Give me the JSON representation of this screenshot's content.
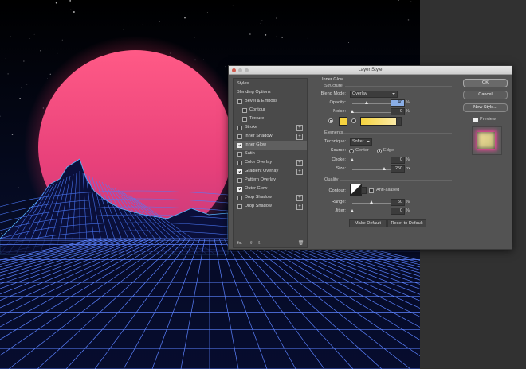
{
  "dialog": {
    "title": "Layer Style"
  },
  "styles_panel": {
    "header": "Styles",
    "items": [
      {
        "label": "Blending Options",
        "checkbox": false,
        "checked": false,
        "plus": false,
        "sub": false
      },
      {
        "label": "Bevel & Emboss",
        "checkbox": true,
        "checked": false,
        "plus": false,
        "sub": false
      },
      {
        "label": "Contour",
        "checkbox": true,
        "checked": false,
        "plus": false,
        "sub": true
      },
      {
        "label": "Texture",
        "checkbox": true,
        "checked": false,
        "plus": false,
        "sub": true
      },
      {
        "label": "Stroke",
        "checkbox": true,
        "checked": false,
        "plus": true,
        "sub": false
      },
      {
        "label": "Inner Shadow",
        "checkbox": true,
        "checked": false,
        "plus": true,
        "sub": false
      },
      {
        "label": "Inner Glow",
        "checkbox": true,
        "checked": true,
        "plus": false,
        "sub": false,
        "selected": true
      },
      {
        "label": "Satin",
        "checkbox": true,
        "checked": false,
        "plus": false,
        "sub": false
      },
      {
        "label": "Color Overlay",
        "checkbox": true,
        "checked": false,
        "plus": true,
        "sub": false
      },
      {
        "label": "Gradient Overlay",
        "checkbox": true,
        "checked": true,
        "plus": true,
        "sub": false
      },
      {
        "label": "Pattern Overlay",
        "checkbox": true,
        "checked": false,
        "plus": false,
        "sub": false
      },
      {
        "label": "Outer Glow",
        "checkbox": true,
        "checked": true,
        "plus": false,
        "sub": false
      },
      {
        "label": "Drop Shadow",
        "checkbox": true,
        "checked": false,
        "plus": true,
        "sub": false
      },
      {
        "label": "Drop Shadow",
        "checkbox": true,
        "checked": false,
        "plus": true,
        "sub": false
      }
    ],
    "footer_fx": "fx."
  },
  "inner_glow": {
    "title": "Inner Glow",
    "structure": {
      "heading": "Structure",
      "blend_mode_label": "Blend Mode:",
      "blend_mode_value": "Overlay",
      "opacity_label": "Opacity:",
      "opacity_value": "40",
      "opacity_unit": "%",
      "noise_label": "Noise:",
      "noise_value": "0",
      "noise_unit": "%"
    },
    "elements": {
      "heading": "Elements",
      "technique_label": "Technique:",
      "technique_value": "Softer",
      "source_label": "Source:",
      "source_center": "Center",
      "source_edge": "Edge",
      "choke_label": "Choke:",
      "choke_value": "0",
      "choke_unit": "%",
      "size_label": "Size:",
      "size_value": "250",
      "size_unit": "px"
    },
    "quality": {
      "heading": "Quality",
      "contour_label": "Contour:",
      "anti_aliased_label": "Anti-aliased",
      "range_label": "Range:",
      "range_value": "50",
      "range_unit": "%",
      "jitter_label": "Jitter:",
      "jitter_value": "0",
      "jitter_unit": "%"
    },
    "make_default": "Make Default",
    "reset_default": "Reset to Default"
  },
  "buttons": {
    "ok": "OK",
    "cancel": "Cancel",
    "new_style": "New Style...",
    "preview": "Preview"
  },
  "colors": {
    "glow_swatch": "#f6d33f",
    "accent": "#8aaee6"
  }
}
